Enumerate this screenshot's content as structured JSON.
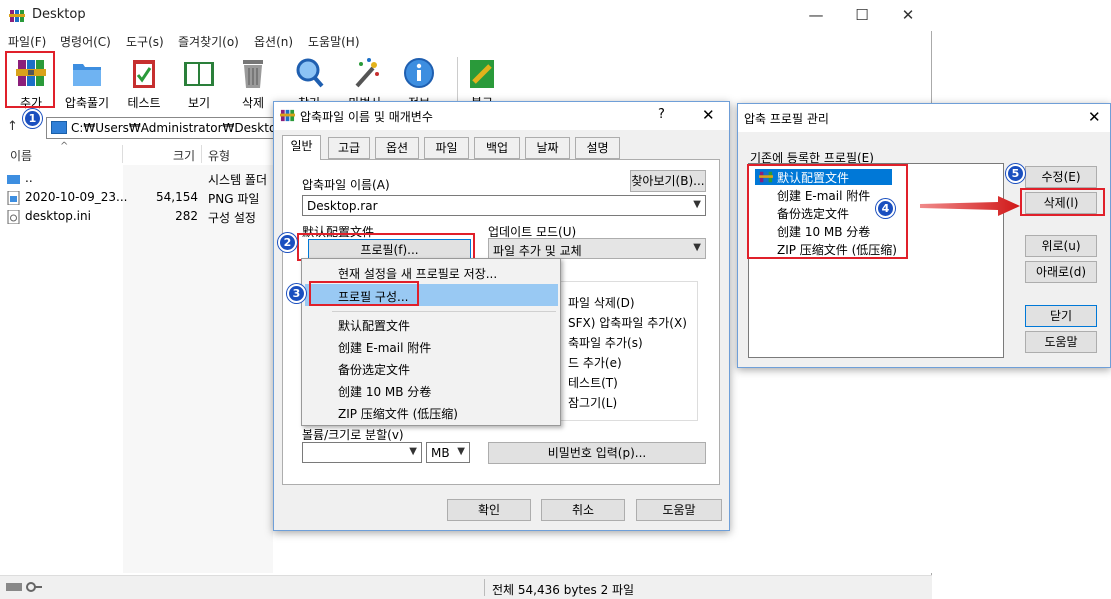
{
  "window": {
    "title": "Desktop",
    "minimize": "—",
    "maximize": "☐",
    "close": "✕"
  },
  "menu": [
    "파일(F)",
    "명령어(C)",
    "도구(s)",
    "즐겨찾기(o)",
    "옵션(n)",
    "도움말(H)"
  ],
  "toolbar": [
    "추가",
    "압축풀기",
    "테스트",
    "보기",
    "삭제",
    "찾기",
    "마법사",
    "정보",
    "복구"
  ],
  "address": {
    "path": "C:₩Users₩Administrator₩Desktop"
  },
  "columns": {
    "name": "이름",
    "size": "크기",
    "type": "유형"
  },
  "files": [
    {
      "name": "..",
      "size": "",
      "type": "시스템 폴더"
    },
    {
      "name": "2020-10-09_23...",
      "size": "54,154",
      "type": "PNG 파일"
    },
    {
      "name": "desktop.ini",
      "size": "282",
      "type": "구성 설정"
    }
  ],
  "status": "전체 54,436 bytes 2 파일",
  "badges": [
    "1",
    "2",
    "3",
    "4",
    "5"
  ],
  "dialog1": {
    "title": "압축파일 이름 및 매개변수",
    "help": "?",
    "close": "✕",
    "tabs": [
      "일반",
      "고급",
      "옵션",
      "파일",
      "백업",
      "날짜",
      "설명"
    ],
    "archive_label": "압축파일 이름(A)",
    "browse": "찾아보기(B)...",
    "archive_value": "Desktop.rar",
    "default_profile_label": "默认配置文件",
    "profiles_button": "프로필(f)...",
    "update_mode_label": "업데이트 모드(U)",
    "update_mode_value": "파일 추가 및 교체",
    "options": [
      "파일 삭제(D)",
      "SFX) 압축파일 추가(X)",
      "축파일 추가(s)",
      "드 추가(e)",
      "테스트(T)",
      "잠그기(L)"
    ],
    "volume_label": "볼륨/크기로 분할(v)",
    "volume_unit": "MB",
    "password": "비밀번호 입력(p)...",
    "ok": "확인",
    "cancel": "취소",
    "helpbtn": "도움말"
  },
  "popup": {
    "save": "현재 설정을 새 프로필로 저장...",
    "organize": "프로필 구성...",
    "profiles": [
      "默认配置文件",
      "创建 E-mail 附件",
      "备份选定文件",
      "创建 10 MB 分卷",
      "ZIP 压缩文件 (低压缩)"
    ]
  },
  "dialog2": {
    "title": "압축 프로필 관리",
    "close": "✕",
    "list_label": "기존에 등록한 프로필(E)",
    "profiles": [
      "默认配置文件",
      "创建 E-mail 附件",
      "备份选定文件",
      "创建 10 MB 分卷",
      "ZIP 压缩文件 (低压缩)"
    ],
    "buttons": {
      "edit": "수정(E)",
      "delete": "삭제(l)",
      "up": "위로(u)",
      "down": "아래로(d)",
      "close": "닫기",
      "help": "도움말"
    }
  },
  "colors": {
    "highlight_red": "#e0202a",
    "badge_blue": "#1a4fbf",
    "selection": "#0078d7",
    "menu_hover": "#99c9f3"
  }
}
